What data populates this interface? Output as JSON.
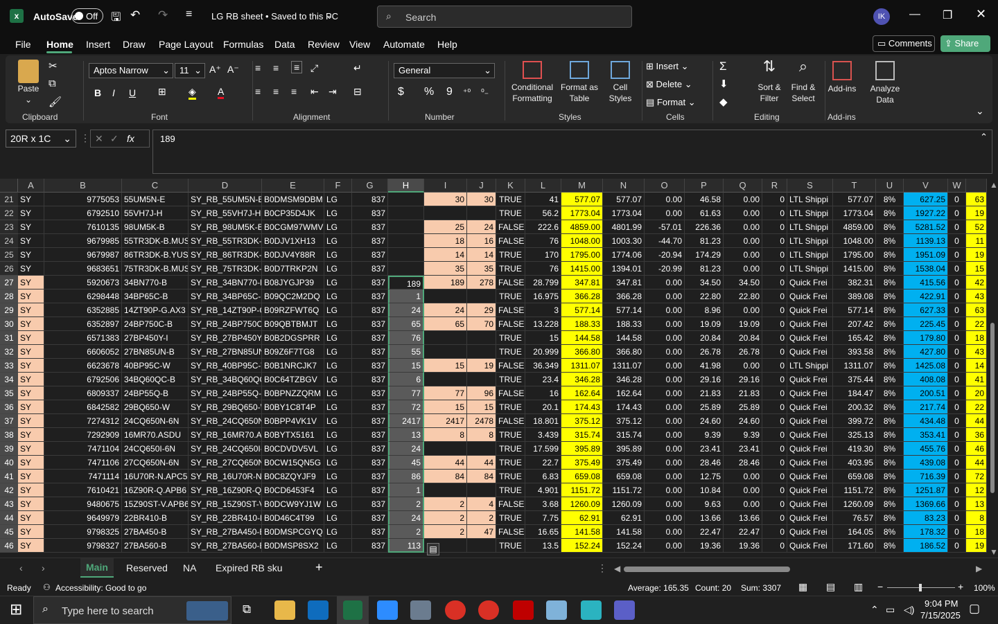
{
  "titlebar": {
    "autosave_label": "AutoSave",
    "autosave_state": "Off",
    "doc_title": "LG RB sheet • Saved to this PC",
    "search_placeholder": "Search",
    "avatar_initials": "IK"
  },
  "menu": {
    "items": [
      "File",
      "Home",
      "Insert",
      "Draw",
      "Page Layout",
      "Formulas",
      "Data",
      "Review",
      "View",
      "Automate",
      "Help"
    ],
    "active": "Home",
    "comments_label": "Comments",
    "share_label": "Share"
  },
  "ribbon": {
    "clipboard": {
      "paste": "Paste",
      "group": "Clipboard"
    },
    "font": {
      "name": "Aptos Narrow",
      "size": "11",
      "group": "Font",
      "bold": "B",
      "italic": "I",
      "underline": "U"
    },
    "alignment": {
      "group": "Alignment"
    },
    "number": {
      "format": "General",
      "group": "Number",
      "currency": "$",
      "percent": "%",
      "comma": "9"
    },
    "styles": {
      "conditional": "Conditional Formatting",
      "format_table": "Format as Table",
      "cell_styles": "Cell Styles",
      "group": "Styles"
    },
    "cells": {
      "insert": "Insert",
      "delete": "Delete",
      "format": "Format",
      "group": "Cells"
    },
    "editing": {
      "sort": "Sort & Filter",
      "find": "Find & Select",
      "group": "Editing"
    },
    "addins": {
      "addins": "Add-ins",
      "analyze": "Analyze Data",
      "group": "Add-ins"
    },
    "brand_color_green": "#1e7145"
  },
  "formula_bar": {
    "name_box": "20R x 1C",
    "fx": "fx",
    "value": "189"
  },
  "columns": [
    "A",
    "B",
    "C",
    "D",
    "E",
    "F",
    "G",
    "H",
    "I",
    "J",
    "K",
    "L",
    "M",
    "N",
    "O",
    "P",
    "Q",
    "R",
    "S",
    "T",
    "U",
    "V",
    "W"
  ],
  "rows": [
    {
      "r": "21",
      "A": "SY",
      "B": "9775053",
      "C": "55UM5N-E",
      "D": "SY_RB_55UM5N-E",
      "E": "B0DMSM9DBM",
      "F": "LG",
      "G": "837",
      "H": "",
      "I": "30",
      "J": "30",
      "K": "TRUE",
      "L": "41",
      "M": "577.07",
      "N": "577.07",
      "O": "0.00",
      "P": "46.58",
      "Q": "0.00",
      "R": "0",
      "S": "LTL Shippi",
      "T": "577.07",
      "U": "8%",
      "V": "627.25",
      "W": "0",
      "X": "63"
    },
    {
      "r": "22",
      "A": "SY",
      "B": "6792510",
      "C": "55VH7J-H",
      "D": "SY_RB_55VH7J-H",
      "E": "B0CP35D4JK",
      "F": "LG",
      "G": "837",
      "H": "",
      "I": "",
      "J": "",
      "K": "TRUE",
      "L": "56.2",
      "M": "1773.04",
      "N": "1773.04",
      "O": "0.00",
      "P": "61.63",
      "Q": "0.00",
      "R": "0",
      "S": "LTL Shippi",
      "T": "1773.04",
      "U": "8%",
      "V": "1927.22",
      "W": "0",
      "X": "19"
    },
    {
      "r": "23",
      "A": "SY",
      "B": "7610135",
      "C": "98UM5K-B",
      "D": "SY_RB_98UM5K-B",
      "E": "B0CGM97WMV",
      "F": "LG",
      "G": "837",
      "H": "",
      "I": "25",
      "J": "24",
      "K": "FALSE",
      "L": "222.6",
      "M": "4859.00",
      "N": "4801.99",
      "O": "-57.01",
      "P": "226.36",
      "Q": "0.00",
      "R": "0",
      "S": "LTL Shippi",
      "T": "4859.00",
      "U": "8%",
      "V": "5281.52",
      "W": "0",
      "X": "52"
    },
    {
      "r": "24",
      "A": "SY",
      "B": "9679985",
      "C": "55TR3DK-B.MUS",
      "D": "SY_RB_55TR3DK-B",
      "E": "B0DJV1XH13",
      "F": "LG",
      "G": "837",
      "H": "",
      "I": "18",
      "J": "16",
      "K": "FALSE",
      "L": "76",
      "M": "1048.00",
      "N": "1003.30",
      "O": "-44.70",
      "P": "81.23",
      "Q": "0.00",
      "R": "0",
      "S": "LTL Shippi",
      "T": "1048.00",
      "U": "8%",
      "V": "1139.13",
      "W": "0",
      "X": "11"
    },
    {
      "r": "25",
      "A": "SY",
      "B": "9679987",
      "C": "86TR3DK-B.YUS",
      "D": "SY_RB_86TR3DK-B",
      "E": "B0DJV4Y88R",
      "F": "LG",
      "G": "837",
      "H": "",
      "I": "14",
      "J": "14",
      "K": "TRUE",
      "L": "170",
      "M": "1795.00",
      "N": "1774.06",
      "O": "-20.94",
      "P": "174.29",
      "Q": "0.00",
      "R": "0",
      "S": "LTL Shippi",
      "T": "1795.00",
      "U": "8%",
      "V": "1951.09",
      "W": "0",
      "X": "19"
    },
    {
      "r": "26",
      "A": "SY",
      "B": "9683651",
      "C": "75TR3DK-B.MUS",
      "D": "SY_RB_75TR3DK-B",
      "E": "B0D7TRKP2N",
      "F": "LG",
      "G": "837",
      "H": "",
      "I": "35",
      "J": "35",
      "K": "TRUE",
      "L": "76",
      "M": "1415.00",
      "N": "1394.01",
      "O": "-20.99",
      "P": "81.23",
      "Q": "0.00",
      "R": "0",
      "S": "LTL Shippi",
      "T": "1415.00",
      "U": "8%",
      "V": "1538.04",
      "W": "0",
      "X": "15"
    },
    {
      "r": "27",
      "A": "SY",
      "B": "5920673",
      "C": "34BN770-B",
      "D": "SY_RB_34BN770-B",
      "E": "B08JYGJP39",
      "F": "LG",
      "G": "837",
      "H": "189",
      "I": "189",
      "J": "278",
      "K": "FALSE",
      "L": "28.799",
      "M": "347.81",
      "N": "347.81",
      "O": "0.00",
      "P": "34.50",
      "Q": "34.50",
      "R": "0",
      "S": "Quick Frei",
      "T": "382.31",
      "U": "8%",
      "V": "415.56",
      "W": "0",
      "X": "42"
    },
    {
      "r": "28",
      "A": "SY",
      "B": "6298448",
      "C": "34BP65C-B",
      "D": "SY_RB_34BP65C-B",
      "E": "B09QC2M2DQ",
      "F": "LG",
      "G": "837",
      "H": "1",
      "I": "",
      "J": "",
      "K": "TRUE",
      "L": "16.975",
      "M": "366.28",
      "N": "366.28",
      "O": "0.00",
      "P": "22.80",
      "Q": "22.80",
      "R": "0",
      "S": "Quick Frei",
      "T": "389.08",
      "U": "8%",
      "V": "422.91",
      "W": "0",
      "X": "43"
    },
    {
      "r": "29",
      "A": "SY",
      "B": "6352885",
      "C": "14ZT90P-G.AX3",
      "D": "SY_RB_14ZT90P-G",
      "E": "B09RZFWT6Q",
      "F": "LG",
      "G": "837",
      "H": "24",
      "I": "24",
      "J": "29",
      "K": "FALSE",
      "L": "3",
      "M": "577.14",
      "N": "577.14",
      "O": "0.00",
      "P": "8.96",
      "Q": "0.00",
      "R": "0",
      "S": "Quick Frei",
      "T": "577.14",
      "U": "8%",
      "V": "627.33",
      "W": "0",
      "X": "63"
    },
    {
      "r": "30",
      "A": "SY",
      "B": "6352897",
      "C": "24BP750C-B",
      "D": "SY_RB_24BP750C",
      "E": "B09QBTBMJT",
      "F": "LG",
      "G": "837",
      "H": "65",
      "I": "65",
      "J": "70",
      "K": "FALSE",
      "L": "13.228",
      "M": "188.33",
      "N": "188.33",
      "O": "0.00",
      "P": "19.09",
      "Q": "19.09",
      "R": "0",
      "S": "Quick Frei",
      "T": "207.42",
      "U": "8%",
      "V": "225.45",
      "W": "0",
      "X": "22"
    },
    {
      "r": "31",
      "A": "SY",
      "B": "6571383",
      "C": "27BP450Y-I",
      "D": "SY_RB_27BP450Y-",
      "E": "B0B2DGSPRR",
      "F": "LG",
      "G": "837",
      "H": "76",
      "I": "",
      "J": "",
      "K": "TRUE",
      "L": "15",
      "M": "144.58",
      "N": "144.58",
      "O": "0.00",
      "P": "20.84",
      "Q": "20.84",
      "R": "0",
      "S": "Quick Frei",
      "T": "165.42",
      "U": "8%",
      "V": "179.80",
      "W": "0",
      "X": "18"
    },
    {
      "r": "32",
      "A": "SY",
      "B": "6606052",
      "C": "27BN85UN-B",
      "D": "SY_RB_27BN85UN",
      "E": "B09Z6F7TG8",
      "F": "LG",
      "G": "837",
      "H": "55",
      "I": "",
      "J": "",
      "K": "TRUE",
      "L": "20.999",
      "M": "366.80",
      "N": "366.80",
      "O": "0.00",
      "P": "26.78",
      "Q": "26.78",
      "R": "0",
      "S": "Quick Frei",
      "T": "393.58",
      "U": "8%",
      "V": "427.80",
      "W": "0",
      "X": "43"
    },
    {
      "r": "33",
      "A": "SY",
      "B": "6623678",
      "C": "40BP95C-W",
      "D": "SY_RB_40BP95C-W",
      "E": "B0B1NRCJK7",
      "F": "LG",
      "G": "837",
      "H": "15",
      "I": "15",
      "J": "19",
      "K": "FALSE",
      "L": "36.349",
      "M": "1311.07",
      "N": "1311.07",
      "O": "0.00",
      "P": "41.98",
      "Q": "0.00",
      "R": "0",
      "S": "LTL Shippi",
      "T": "1311.07",
      "U": "8%",
      "V": "1425.08",
      "W": "0",
      "X": "14"
    },
    {
      "r": "34",
      "A": "SY",
      "B": "6792506",
      "C": "34BQ60QC-B",
      "D": "SY_RB_34BQ60QC",
      "E": "B0C64TZBGV",
      "F": "LG",
      "G": "837",
      "H": "6",
      "I": "",
      "J": "",
      "K": "TRUE",
      "L": "23.4",
      "M": "346.28",
      "N": "346.28",
      "O": "0.00",
      "P": "29.16",
      "Q": "29.16",
      "R": "0",
      "S": "Quick Frei",
      "T": "375.44",
      "U": "8%",
      "V": "408.08",
      "W": "0",
      "X": "41"
    },
    {
      "r": "35",
      "A": "SY",
      "B": "6809337",
      "C": "24BP55Q-B",
      "D": "SY_RB_24BP55Q-",
      "E": "B0BPNZZQRM",
      "F": "LG",
      "G": "837",
      "H": "77",
      "I": "77",
      "J": "96",
      "K": "FALSE",
      "L": "16",
      "M": "162.64",
      "N": "162.64",
      "O": "0.00",
      "P": "21.83",
      "Q": "21.83",
      "R": "0",
      "S": "Quick Frei",
      "T": "184.47",
      "U": "8%",
      "V": "200.51",
      "W": "0",
      "X": "20"
    },
    {
      "r": "36",
      "A": "SY",
      "B": "6842582",
      "C": "29BQ650-W",
      "D": "SY_RB_29BQ650-W",
      "E": "B0BY1C8T4P",
      "F": "LG",
      "G": "837",
      "H": "72",
      "I": "15",
      "J": "15",
      "K": "TRUE",
      "L": "20.1",
      "M": "174.43",
      "N": "174.43",
      "O": "0.00",
      "P": "25.89",
      "Q": "25.89",
      "R": "0",
      "S": "Quick Frei",
      "T": "200.32",
      "U": "8%",
      "V": "217.74",
      "W": "0",
      "X": "22"
    },
    {
      "r": "37",
      "A": "SY",
      "B": "7274312",
      "C": "24CQ650N-6N",
      "D": "SY_RB_24CQ650N",
      "E": "B0BPP4VK1V",
      "F": "LG",
      "G": "837",
      "H": "2417",
      "I": "2417",
      "J": "2478",
      "K": "FALSE",
      "L": "18.801",
      "M": "375.12",
      "N": "375.12",
      "O": "0.00",
      "P": "24.60",
      "Q": "24.60",
      "R": "0",
      "S": "Quick Frei",
      "T": "399.72",
      "U": "8%",
      "V": "434.48",
      "W": "0",
      "X": "44"
    },
    {
      "r": "38",
      "A": "SY",
      "B": "7292909",
      "C": "16MR70.ASDU",
      "D": "SY_RB_16MR70.AS",
      "E": "B0BYTX5161",
      "F": "LG",
      "G": "837",
      "H": "13",
      "I": "8",
      "J": "8",
      "K": "TRUE",
      "L": "3.439",
      "M": "315.74",
      "N": "315.74",
      "O": "0.00",
      "P": "9.39",
      "Q": "9.39",
      "R": "0",
      "S": "Quick Frei",
      "T": "325.13",
      "U": "8%",
      "V": "353.41",
      "W": "0",
      "X": "36"
    },
    {
      "r": "39",
      "A": "SY",
      "B": "7471104",
      "C": "24CQ650I-6N",
      "D": "SY_RB_24CQ650I-",
      "E": "B0CDVDV5VL",
      "F": "LG",
      "G": "837",
      "H": "24",
      "I": "",
      "J": "",
      "K": "TRUE",
      "L": "17.599",
      "M": "395.89",
      "N": "395.89",
      "O": "0.00",
      "P": "23.41",
      "Q": "23.41",
      "R": "0",
      "S": "Quick Frei",
      "T": "419.30",
      "U": "8%",
      "V": "455.76",
      "W": "0",
      "X": "46"
    },
    {
      "r": "40",
      "A": "SY",
      "B": "7471106",
      "C": "27CQ650N-6N",
      "D": "SY_RB_27CQ650N",
      "E": "B0CW15QN5G",
      "F": "LG",
      "G": "837",
      "H": "45",
      "I": "44",
      "J": "44",
      "K": "TRUE",
      "L": "22.7",
      "M": "375.49",
      "N": "375.49",
      "O": "0.00",
      "P": "28.46",
      "Q": "28.46",
      "R": "0",
      "S": "Quick Frei",
      "T": "403.95",
      "U": "8%",
      "V": "439.08",
      "W": "0",
      "X": "44"
    },
    {
      "r": "41",
      "A": "SY",
      "B": "7471114",
      "C": "16U70R-N.APC5",
      "D": "SY_RB_16U70R-N",
      "E": "B0C8ZQYJF9",
      "F": "LG",
      "G": "837",
      "H": "86",
      "I": "84",
      "J": "84",
      "K": "TRUE",
      "L": "6.83",
      "M": "659.08",
      "N": "659.08",
      "O": "0.00",
      "P": "12.75",
      "Q": "0.00",
      "R": "0",
      "S": "Quick Frei",
      "T": "659.08",
      "U": "8%",
      "V": "716.39",
      "W": "0",
      "X": "72"
    },
    {
      "r": "42",
      "A": "SY",
      "B": "7610421",
      "C": "16Z90R-Q.APB6",
      "D": "SY_RB_16Z90R-Q",
      "E": "B0CD6453F4",
      "F": "LG",
      "G": "837",
      "H": "1",
      "I": "",
      "J": "",
      "K": "TRUE",
      "L": "4.901",
      "M": "1151.72",
      "N": "1151.72",
      "O": "0.00",
      "P": "10.84",
      "Q": "0.00",
      "R": "0",
      "S": "Quick Frei",
      "T": "1151.72",
      "U": "8%",
      "V": "1251.87",
      "W": "0",
      "X": "12"
    },
    {
      "r": "43",
      "A": "SY",
      "B": "9480675",
      "C": "15Z90ST-V.APB6",
      "D": "SY_RB_15Z90ST-V",
      "E": "B0DCW9YJ1W",
      "F": "LG",
      "G": "837",
      "H": "2",
      "I": "2",
      "J": "4",
      "K": "FALSE",
      "L": "3.68",
      "M": "1260.09",
      "N": "1260.09",
      "O": "0.00",
      "P": "9.63",
      "Q": "0.00",
      "R": "0",
      "S": "Quick Frei",
      "T": "1260.09",
      "U": "8%",
      "V": "1369.66",
      "W": "0",
      "X": "13"
    },
    {
      "r": "44",
      "A": "SY",
      "B": "9649979",
      "C": "22BR410-B",
      "D": "SY_RB_22BR410-B",
      "E": "B0D46C4T99",
      "F": "LG",
      "G": "837",
      "H": "24",
      "I": "2",
      "J": "2",
      "K": "TRUE",
      "L": "7.75",
      "M": "62.91",
      "N": "62.91",
      "O": "0.00",
      "P": "13.66",
      "Q": "13.66",
      "R": "0",
      "S": "Quick Frei",
      "T": "76.57",
      "U": "8%",
      "V": "83.23",
      "W": "0",
      "X": "8"
    },
    {
      "r": "45",
      "A": "SY",
      "B": "9798325",
      "C": "27BA450-B",
      "D": "SY_RB_27BA450-B",
      "E": "B0DMSPCGYQ",
      "F": "LG",
      "G": "837",
      "H": "2",
      "I": "2",
      "J": "47",
      "K": "FALSE",
      "L": "16.65",
      "M": "141.58",
      "N": "141.58",
      "O": "0.00",
      "P": "22.47",
      "Q": "22.47",
      "R": "0",
      "S": "Quick Frei",
      "T": "164.05",
      "U": "8%",
      "V": "178.32",
      "W": "0",
      "X": "18"
    },
    {
      "r": "46",
      "A": "SY",
      "B": "9798327",
      "C": "27BA560-B",
      "D": "SY_RB_27BA560-B",
      "E": "B0DMSP8SX2",
      "F": "LG",
      "G": "837",
      "H": "113",
      "I": "",
      "J": "",
      "K": "TRUE",
      "L": "13.5",
      "M": "152.24",
      "N": "152.24",
      "O": "0.00",
      "P": "19.36",
      "Q": "19.36",
      "R": "0",
      "S": "Quick Frei",
      "T": "171.60",
      "U": "8%",
      "V": "186.52",
      "W": "0",
      "X": "19"
    }
  ],
  "sheets": {
    "tabs": [
      "Main",
      "Reserved",
      "NA",
      "Expired RB sku"
    ],
    "active": "Main",
    "add": "+"
  },
  "status": {
    "ready": "Ready",
    "accessibility": "Accessibility: Good to go",
    "average": "Average: 165.35",
    "count": "Count: 20",
    "sum": "Sum: 3307",
    "zoom": "100%"
  },
  "taskbar": {
    "search_placeholder": "Type here to search",
    "time": "9:04 PM",
    "date": "7/15/2025"
  }
}
